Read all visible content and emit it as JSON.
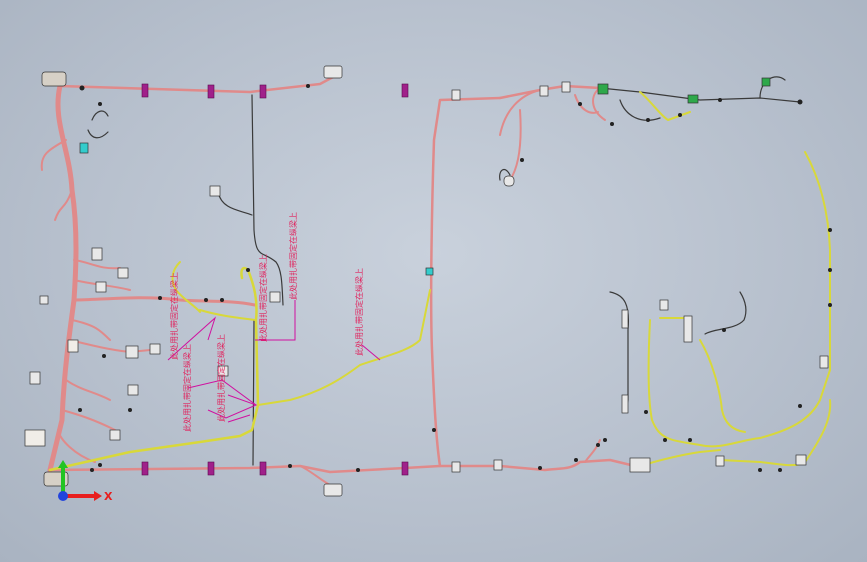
{
  "title": "",
  "colors": {
    "background": "#bac3cf",
    "main_harness": "#e08a8a",
    "yellow_harness": "#d8d83a",
    "dark_wire": "#3a3a3a",
    "clip": "#a0208a",
    "annotation": "#e0245e",
    "axis_x": "#e81e1e",
    "axis_y": "#22c422",
    "axis_z": "#2244dd"
  },
  "annotations": [
    {
      "id": "note-1",
      "text": "此处用扎带固定在纵梁上"
    },
    {
      "id": "note-2",
      "text": "此处用扎带固定在纵梁上"
    },
    {
      "id": "note-3",
      "text": "此处用扎带固定在纵梁上"
    },
    {
      "id": "note-4",
      "text": "此处用扎带固定在纵梁上"
    },
    {
      "id": "note-5",
      "text": "此处用扎带固定在纵梁上"
    },
    {
      "id": "note-6",
      "text": "此处用扎带固定在纵梁上"
    }
  ],
  "axis": {
    "x_label": "X",
    "icon": "coordinate-triad-icon"
  }
}
